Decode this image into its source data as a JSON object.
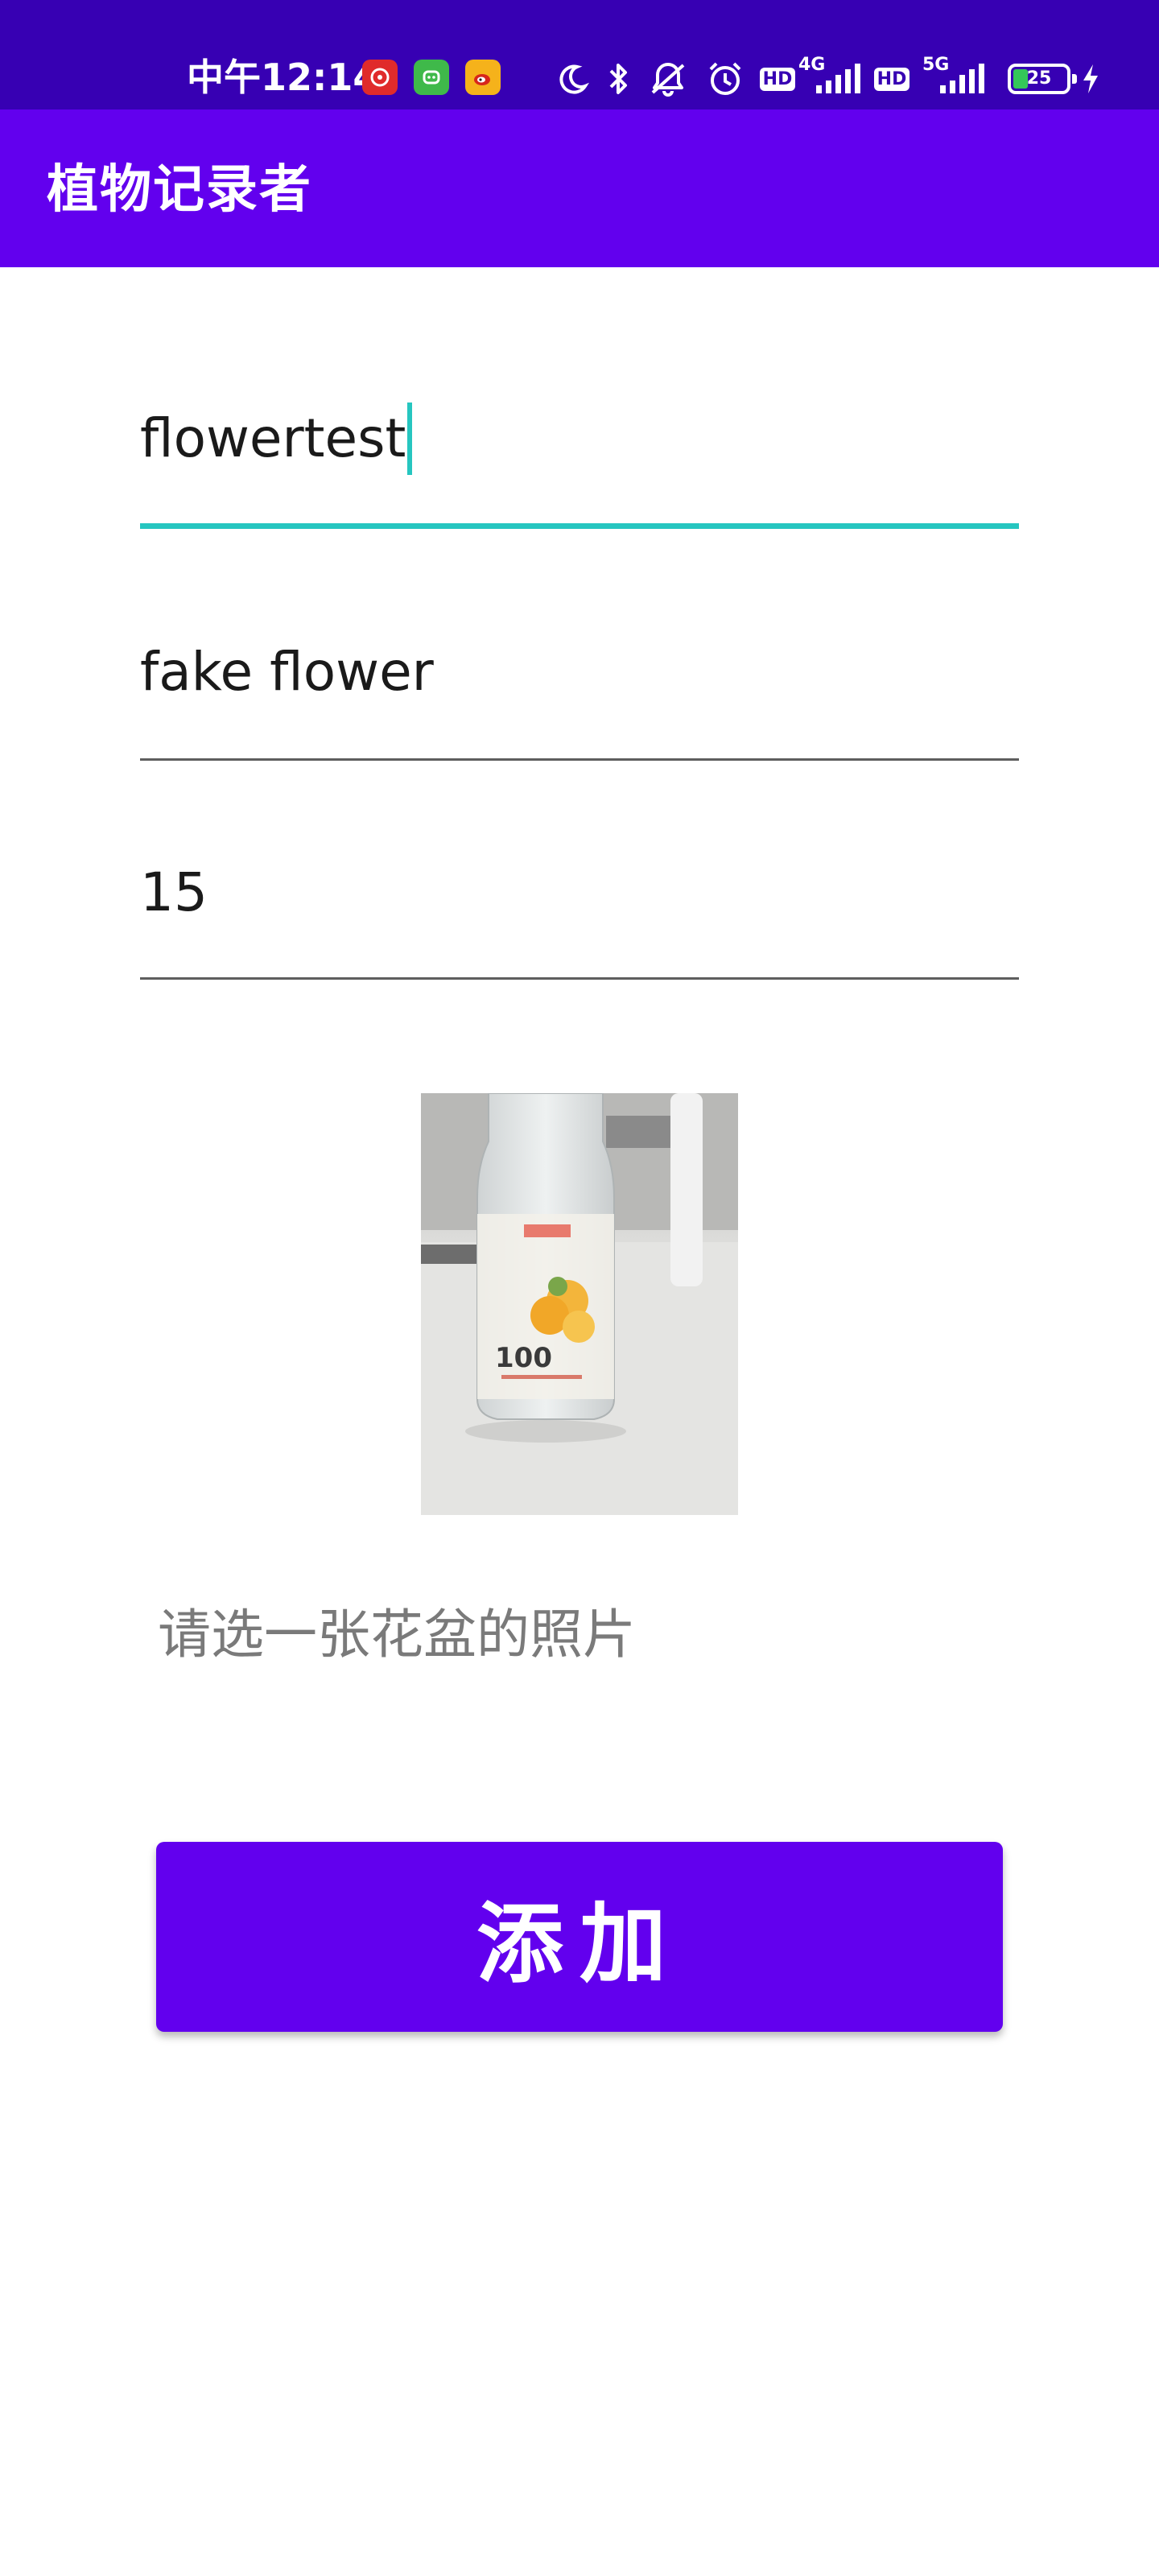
{
  "status_bar": {
    "time": "中午12:14",
    "battery": "25",
    "network_labels": [
      "HD",
      "4G",
      "HD",
      "5G"
    ],
    "colors": {
      "background": "#3700b3"
    },
    "icons": [
      "netease-music-icon",
      "wechat-like-icon",
      "weibo-icon",
      "moon-icon",
      "bluetooth-icon",
      "mute-icon",
      "alarm-icon",
      "signal-icon",
      "battery-icon",
      "charging-icon"
    ]
  },
  "app_bar": {
    "title": "植物记录者",
    "color": "#6200ee"
  },
  "form": {
    "name_value": "flowertest",
    "type_value": "fake flower",
    "count_value": "15",
    "accent_color": "#26c6c0"
  },
  "photo": {
    "photo_hint": "请选一张花盆的照片"
  },
  "actions": {
    "add_label": "添加"
  }
}
